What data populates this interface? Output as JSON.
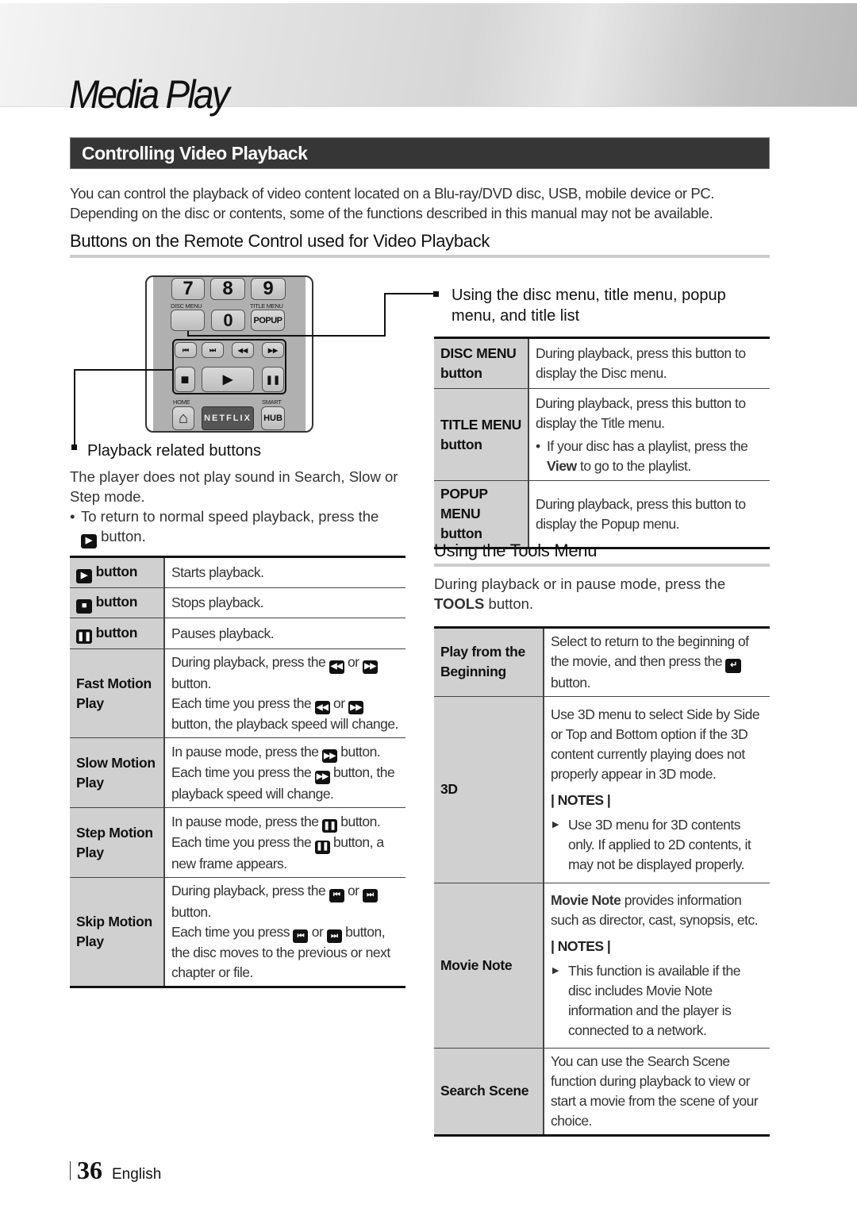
{
  "page": {
    "chapter_title": "Media Play",
    "section_title": "Controlling Video Playback",
    "intro": "You can control the playback of video content located on a Blu-ray/DVD disc, USB, mobile device or PC. Depending on the disc or contents, some of the functions described in this manual may not be available.",
    "subheading": "Buttons on the Remote Control used for Video Playback",
    "page_number": "36",
    "language": "English"
  },
  "remote": {
    "keys": {
      "k7": "7",
      "k8": "8",
      "k9": "9",
      "k0": "0",
      "popup": "POPUP",
      "netflix": "NETFLIX",
      "hub": "HUB"
    },
    "labels": {
      "disc_menu": "DISC MENU",
      "title_menu": "TITLE MENU",
      "home": "HOME",
      "smart": "SMART"
    },
    "icons": {
      "skip_back": "⏮",
      "skip_fwd": "⏭",
      "rewind": "◀◀",
      "fast_fwd": "▶▶",
      "stop": "■",
      "play": "▶",
      "pause": "❚❚",
      "home": "⌂"
    }
  },
  "playback_section": {
    "title": "Playback related buttons",
    "note": "The player does not play sound in Search, Slow or Step mode.",
    "bullet_pre": "To return to normal speed playback, press the",
    "bullet_post": "button.",
    "rows": [
      {
        "key": "button",
        "icon": "play-icon",
        "value": "Starts playback."
      },
      {
        "key": "button",
        "icon": "stop-icon",
        "value": "Stops playback."
      },
      {
        "key": "button",
        "icon": "pause-icon",
        "value": "Pauses playback."
      },
      {
        "key": "Fast Motion Play",
        "l1a": "During playback, press the",
        "or": "or",
        "l1b": "button.",
        "l2a": "Each time you press the",
        "l2b": "button, the playback speed will change."
      },
      {
        "key": "Slow Motion Play",
        "l1a": "In pause mode, press the",
        "l1b": "button.",
        "l2a": "Each time you press the",
        "l2b": "button, the playback speed will change."
      },
      {
        "key": "Step Motion Play",
        "l1a": "In pause mode, press the",
        "l1b": "button.",
        "l2a": "Each time you press the",
        "l2b": "button, a new frame appears."
      },
      {
        "key": "Skip Motion Play",
        "l1a": "During playback, press the",
        "or": "or",
        "l1b": "button.",
        "l2a": "Each time you press",
        "l2b": "button, the disc moves to the previous or next chapter or file."
      }
    ]
  },
  "menu_section": {
    "title": "Using the disc menu, title menu, popup menu, and title list",
    "rows": [
      {
        "key": "DISC MENU button",
        "value": "During playback, press this button to display the Disc menu."
      },
      {
        "key": "TITLE MENU button",
        "value": "During playback, press this button to display the Title menu.",
        "bullet_bold": "View",
        "bullet_pre": "If your disc has a playlist, press the",
        "bullet_post": "to go to the playlist."
      },
      {
        "key": "POPUP MENU button",
        "value": "During playback, press this button to display the Popup menu."
      }
    ]
  },
  "tools_section": {
    "title": "Using the Tools Menu",
    "intro_pre": "During playback or in pause mode, press the",
    "intro_bold": "TOOLS",
    "intro_post": "button.",
    "notes_label": "| NOTES |",
    "rows": [
      {
        "key": "Play from the Beginning",
        "value_pre": "Select to return to the beginning of the movie, and then press the",
        "value_post": "button."
      },
      {
        "key": "3D",
        "value": "Use 3D menu to select Side by Side or Top and Bottom option if the 3D content currently playing does not properly appear in 3D mode.",
        "note": "Use 3D menu for 3D contents only. If applied to 2D contents, it may not be displayed properly."
      },
      {
        "key": "Movie Note",
        "value_bold": "Movie Note",
        "value": "provides information such as director, cast, synopsis, etc.",
        "note": "This function is available if the disc includes Movie Note information and the player is connected to a network."
      },
      {
        "key": "Search Scene",
        "value": "You can use the Search Scene function during playback to view or start a movie from the scene of your choice."
      }
    ]
  }
}
